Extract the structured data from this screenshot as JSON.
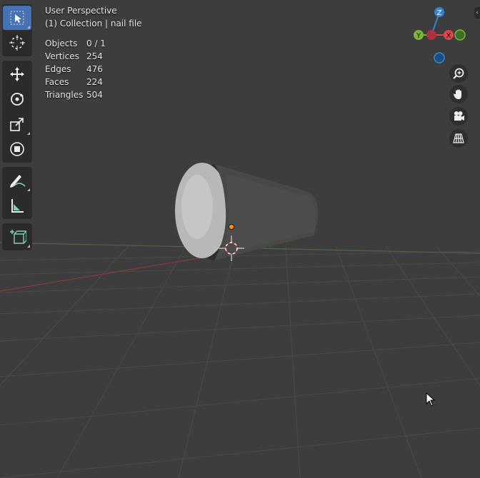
{
  "viewport": {
    "view_name": "User Perspective",
    "collection_line": "(1) Collection | nail file"
  },
  "stats": [
    {
      "label": "Objects",
      "value": "0 / 1"
    },
    {
      "label": "Vertices",
      "value": "254"
    },
    {
      "label": "Edges",
      "value": "476"
    },
    {
      "label": "Faces",
      "value": "224"
    },
    {
      "label": "Triangles",
      "value": "504"
    }
  ],
  "toolbar": {
    "tools": [
      "select-box-icon",
      "cursor-icon",
      "move-icon",
      "rotate-icon",
      "scale-icon",
      "transform-icon",
      "annotate-icon",
      "measure-icon",
      "add-cube-icon"
    ],
    "active": "select-box-icon"
  },
  "gizmo": {
    "z_label": "Z",
    "y_label": "Y",
    "x_label": "X",
    "colors": {
      "x": "#e2414e",
      "y": "#7bb536",
      "z": "#2f86d6"
    }
  },
  "navigation": [
    "zoom-icon",
    "pan-hand-icon",
    "camera-icon",
    "perspective-grid-icon"
  ],
  "colors": {
    "background": "#3d3d3d",
    "active_tool": "#4772b3",
    "object_origin": "#ff8a1a"
  }
}
